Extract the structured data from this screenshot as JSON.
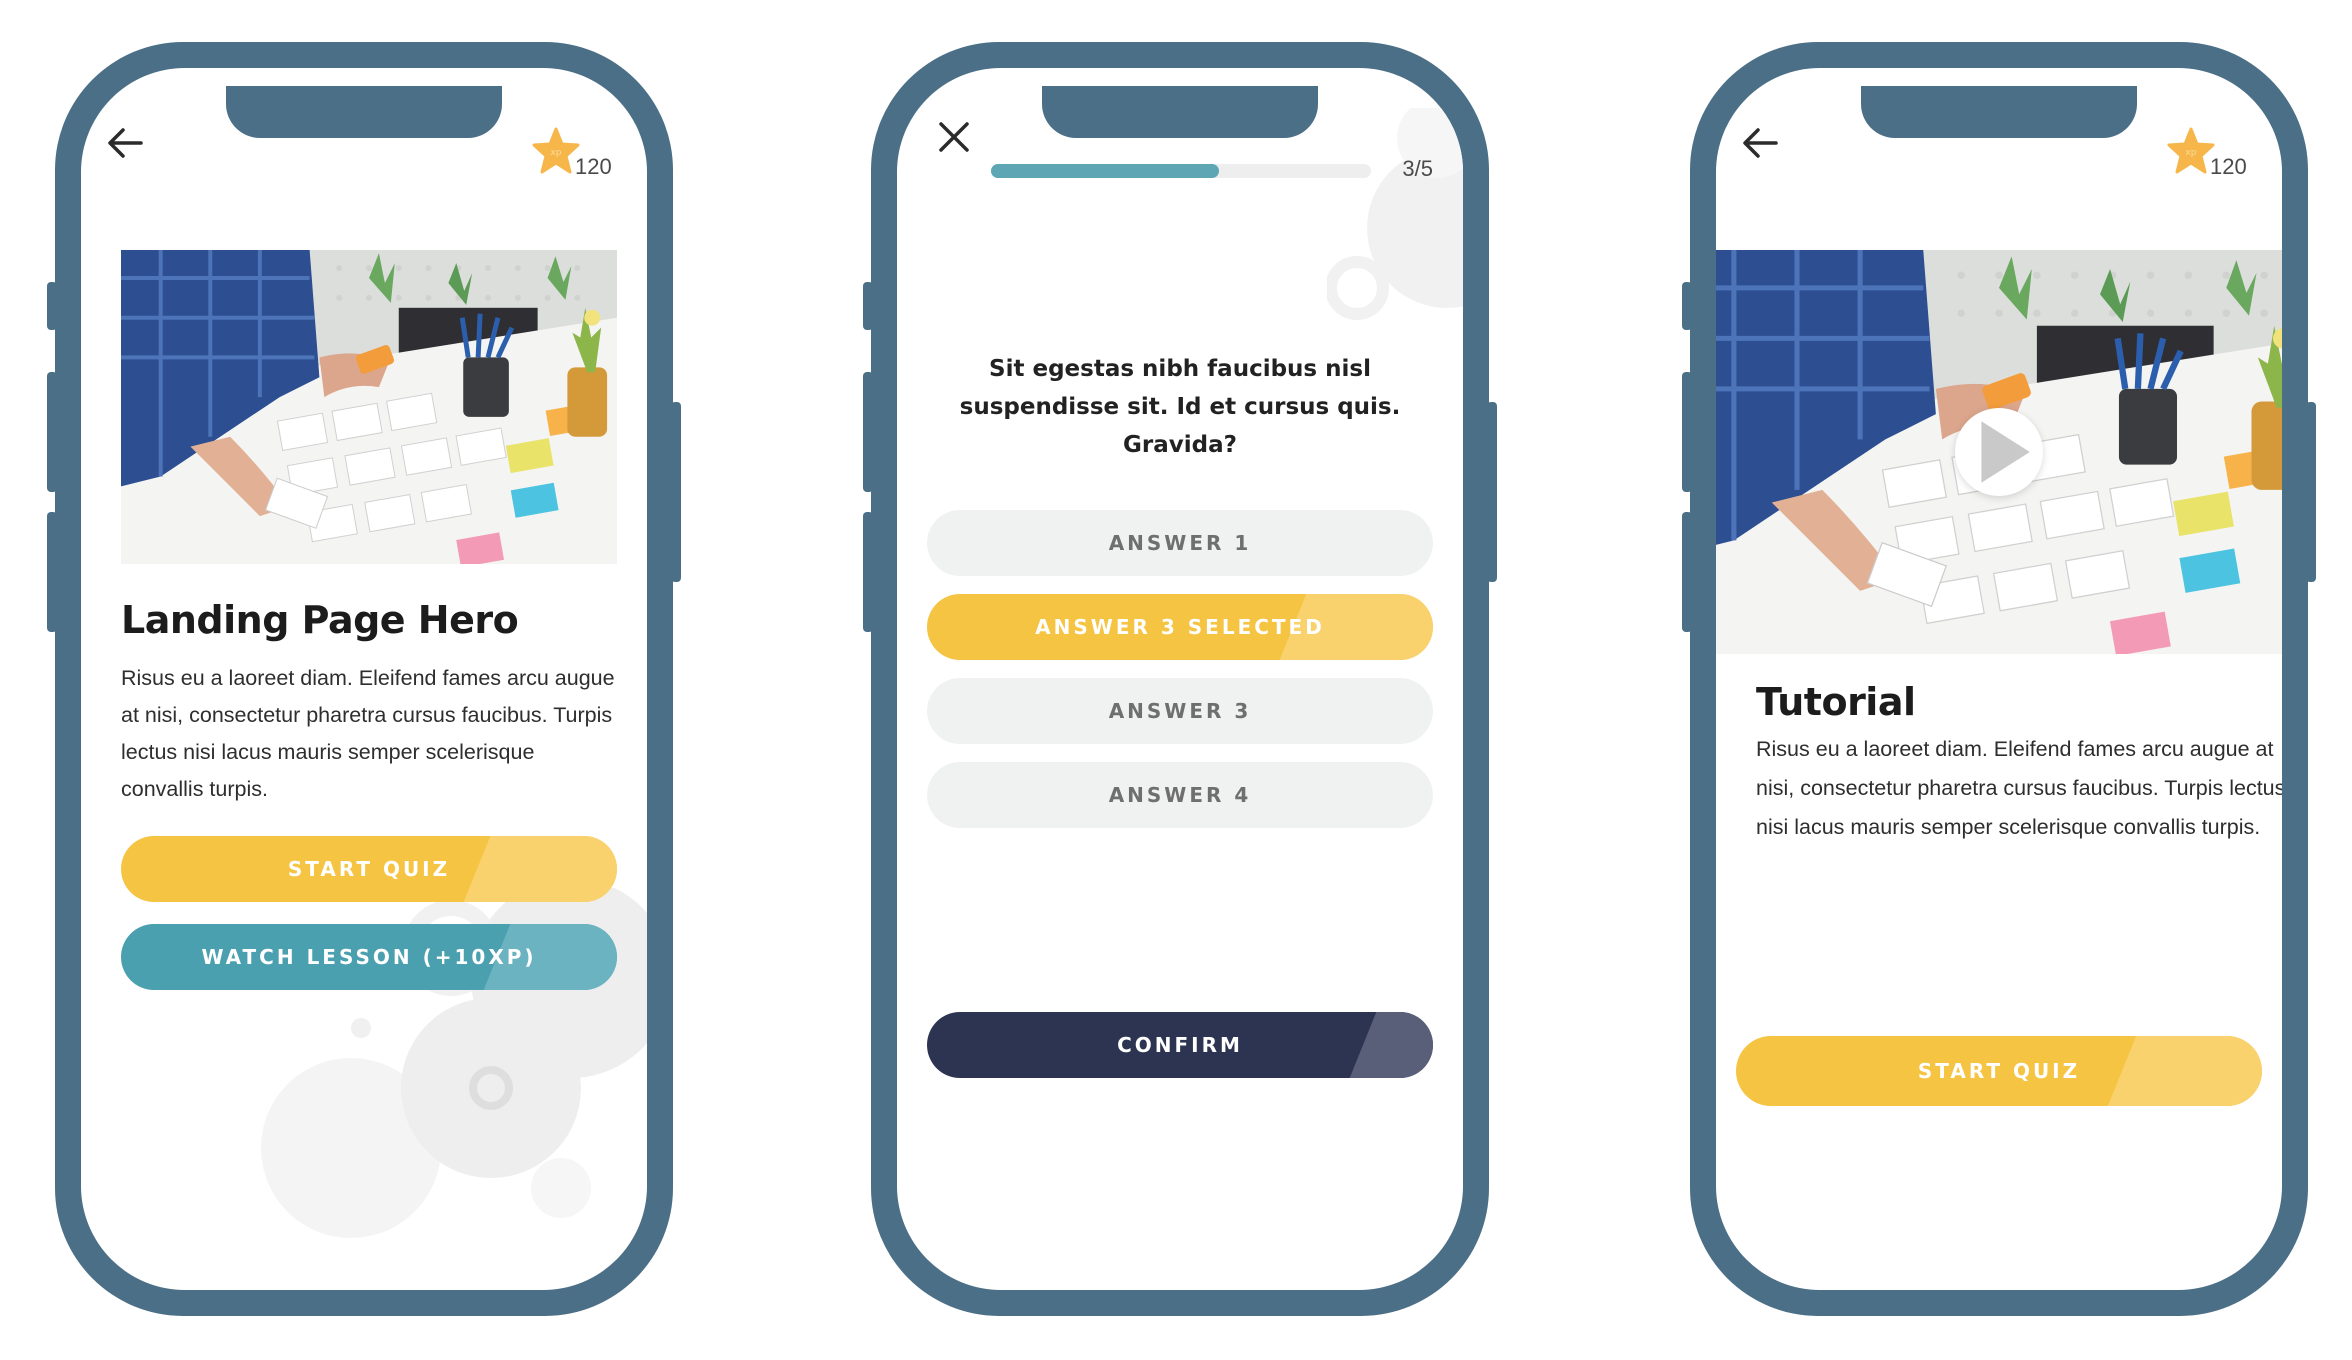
{
  "xp": {
    "value": "120",
    "badge_label": "xp"
  },
  "lesson": {
    "title": "Landing Page Hero",
    "body": "Risus eu a laoreet diam. Eleifend fames arcu augue at nisi, consectetur pharetra cursus faucibus. Turpis lectus nisi lacus mauris semper scelerisque convallis turpis.",
    "start_quiz_label": "START QUIZ",
    "watch_lesson_label": "WATCH LESSON (+10XP)"
  },
  "quiz": {
    "progress_text": "3/5",
    "progress_fraction": 0.6,
    "question": "Sit egestas nibh faucibus nisl suspendisse sit. Id et cursus quis. Gravida?",
    "answers": [
      {
        "label": "ANSWER 1",
        "selected": false
      },
      {
        "label": "ANSWER 3 SELECTED",
        "selected": true
      },
      {
        "label": "ANSWER 3",
        "selected": false
      },
      {
        "label": "ANSWER 4",
        "selected": false
      }
    ],
    "confirm_label": "CONFIRM"
  },
  "tutorial": {
    "title": "Tutorial",
    "body": "Risus eu a laoreet diam. Eleifend fames arcu augue at nisi, consectetur pharetra cursus faucibus. Turpis lectus nisi lacus mauris semper scelerisque convallis turpis.",
    "start_quiz_label": "START QUIZ"
  },
  "colors": {
    "frame": "#4b6f86",
    "yellow": "#f6c443",
    "teal": "#4ba0b0",
    "navy": "#2c3451",
    "progress": "#5fa6b4"
  },
  "icons": [
    "back-arrow-icon",
    "close-icon",
    "xp-star-icon",
    "play-icon"
  ]
}
